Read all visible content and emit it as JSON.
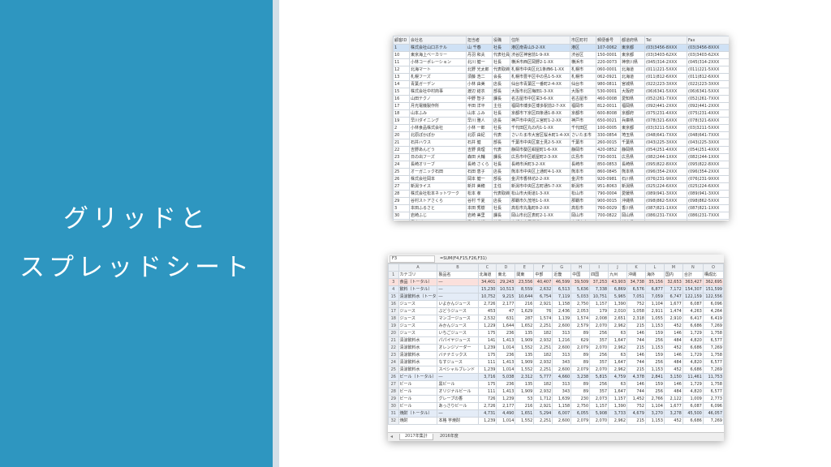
{
  "slide": {
    "title_lines": [
      "グリッドと",
      "スプレッドシート"
    ],
    "colors": {
      "panel": "#2e96c0",
      "strip": "#d3dfe8",
      "title": "#ffffff",
      "grid_selection": "#cfe1f5",
      "sheet_total_row": "#fbe0dc",
      "sheet_subtotal_row": "#e4ecf7"
    }
  },
  "grid": {
    "headers": [
      "顧客ID",
      "会社名",
      "担当者",
      "役職",
      "住所",
      "市区町村",
      "郵便番号",
      "都道府県",
      "Tel",
      "Fax"
    ],
    "rows": [
      [
        "1",
        "株式会社山口ホテル",
        "山 千春",
        "社長",
        "港区南青山3-2-XX",
        "港区",
        "107-0062",
        "東京都",
        "(03)3456-8XXX",
        "(03)3456-8XXX"
      ],
      [
        "10",
        "東京海上ベーカリー",
        "丹羽 和夫",
        "代表社員",
        "渋谷区神宮前1-9-XX",
        "渋谷区",
        "150-0001",
        "東京都",
        "(03)3403-62XX",
        "(03)3403-62XX"
      ],
      [
        "11",
        "小林コーポレーション",
        "北川 健一",
        "社長",
        "横浜市西区岡野2-1-XX",
        "横浜市",
        "220-0073",
        "神奈川県",
        "(045)314-2XXX",
        "(045)314-2XXX"
      ],
      [
        "12",
        "北海マート",
        "北野 光太郎",
        "代表取締役",
        "札幌市中央区北1条西6-1-XX",
        "札幌市",
        "060-0001",
        "北海道",
        "(011)221-5XXX",
        "(011)221-5XXX"
      ],
      [
        "13",
        "札幌フーズ",
        "須藤 浩二",
        "会長",
        "札幌市豊平区中の島1-5-XX",
        "札幌市",
        "062-0921",
        "北海道",
        "(011)812-6XXX",
        "(011)812-6XXX"
      ],
      [
        "14",
        "青葉ガーデン",
        "小林 由美",
        "店長",
        "仙台市青葉区一番町2-4-XX",
        "仙台市",
        "980-0811",
        "宮城県",
        "(022)223-3XXX",
        "(022)223-3XXX"
      ],
      [
        "15",
        "株式会社中村商事",
        "渡辺 結衣",
        "部長",
        "大阪市北区梅田1-3-XX",
        "大阪市",
        "530-0001",
        "大阪府",
        "(06)6341-5XXX",
        "(06)6341-5XXX"
      ],
      [
        "16",
        "山田テクノ",
        "中野 智子",
        "課長",
        "名古屋市中区栄3-6-XX",
        "名古屋市",
        "460-0008",
        "愛知県",
        "(052)261-7XXX",
        "(052)261-7XXX"
      ],
      [
        "17",
        "月光電機製作所",
        "平田 洋平",
        "主任",
        "福岡市博多区博多駅前2-7-XX",
        "福岡市",
        "812-0011",
        "福岡県",
        "(092)441-2XXX",
        "(092)441-2XXX"
      ],
      [
        "18",
        "山本ふみ",
        "山本 ふみ",
        "社長",
        "京都市下京区四条通1-8-XX",
        "京都市",
        "600-8008",
        "京都府",
        "(075)231-4XXX",
        "(075)231-4XXX"
      ],
      [
        "19",
        "早川ダイニング",
        "早川 雅人",
        "店長",
        "神戸市中央区三宮町1-2-XX",
        "神戸市",
        "650-0021",
        "兵庫県",
        "(078)321-6XXX",
        "(078)321-6XXX"
      ],
      [
        "2",
        "小林食品株式会社",
        "小林 一郎",
        "社長",
        "千代田区丸の内1-1-XX",
        "千代田区",
        "100-0005",
        "東京都",
        "(03)3211-5XXX",
        "(03)3211-5XXX"
      ],
      [
        "20",
        "北原ぽかぽか",
        "北原 由紀",
        "代表",
        "さいたま市大宮区桜木町1-4-XX",
        "さいたま市",
        "330-0854",
        "埼玉県",
        "(048)641-7XXX",
        "(048)641-7XXX"
      ],
      [
        "21",
        "石井ハウス",
        "石井 健",
        "部長",
        "千葉市中央区富士見2-5-XX",
        "千葉市",
        "260-0015",
        "千葉県",
        "(043)225-3XXX",
        "(043)225-3XXX"
      ],
      [
        "22",
        "吉野あんどう",
        "吉野 真理",
        "代表",
        "静岡市葵区紺屋町1-6-XX",
        "静岡市",
        "420-0852",
        "静岡県",
        "(054)251-4XXX",
        "(054)251-4XXX"
      ],
      [
        "23",
        "日の出フーズ",
        "森田 大輔",
        "課長",
        "広島市中区紙屋町2-3-XX",
        "広島市",
        "730-0031",
        "広島県",
        "(082)244-1XXX",
        "(082)244-1XXX"
      ],
      [
        "24",
        "長崎オリーブ",
        "長崎 さくら",
        "社長",
        "長崎市浜町3-2-XX",
        "長崎市",
        "850-0853",
        "長崎県",
        "(095)822-8XXX",
        "(095)822-8XXX"
      ],
      [
        "25",
        "オーガニック石田",
        "石田 恵子",
        "店長",
        "熊本市中央区上通町4-1-XX",
        "熊本市",
        "860-0845",
        "熊本県",
        "(096)354-2XXX",
        "(096)354-2XXX"
      ],
      [
        "26",
        "株式会社岡本",
        "岡本 健一",
        "部長",
        "金沢市香林坊2-2-XX",
        "金沢市",
        "920-0981",
        "石川県",
        "(076)231-9XXX",
        "(076)231-9XXX"
      ],
      [
        "27",
        "新潟ライス",
        "新井 美穂",
        "主任",
        "新潟市中央区古町通5-7-XX",
        "新潟市",
        "951-8063",
        "新潟県",
        "(025)224-6XXX",
        "(025)224-6XXX"
      ],
      [
        "28",
        "株式会社松本ネットワーク",
        "松本 孝",
        "代表取締役",
        "松山市大街道1-3-XX",
        "松山市",
        "790-0004",
        "愛媛県",
        "(089)941-3XXX",
        "(089)941-3XXX"
      ],
      [
        "29",
        "谷村ストアさくら",
        "谷村 千夏",
        "店長",
        "那覇市久茂地1-1-XX",
        "那覇市",
        "900-0015",
        "沖縄県",
        "(098)862-5XXX",
        "(098)862-5XXX"
      ],
      [
        "3",
        "本田ふるさと",
        "本田 秀樹",
        "社長",
        "高松市丸亀町8-2-XX",
        "高松市",
        "760-0029",
        "香川県",
        "(087)821-1XXX",
        "(087)821-1XXX"
      ],
      [
        "30",
        "岩崎ふじ",
        "岩崎 美里",
        "課長",
        "岡山市北区表町2-1-XX",
        "岡山市",
        "700-0822",
        "岡山県",
        "(086)231-7XXX",
        "(086)231-7XXX"
      ],
      [
        "31",
        "青木ばく",
        "青木 大輝",
        "社長",
        "宇都宮市馬場通り1-1-XX",
        "宇都宮市",
        "320-0026",
        "栃木県",
        "(028)633-2XXX",
        "(028)633-2XXX"
      ]
    ]
  },
  "sheet": {
    "namebox": "F3",
    "formula": "=SUM(F4,F15,F26,F31)",
    "col_letters": [
      "",
      "A",
      "B",
      "C",
      "D",
      "E",
      "F",
      "G",
      "H",
      "I",
      "J",
      "K",
      "L",
      "M",
      "N",
      "O"
    ],
    "header_row": [
      "1",
      "カテゴリ",
      "製品名",
      "北海道",
      "東北",
      "関東",
      "中部",
      "近畿",
      "中国",
      "四国",
      "九州",
      "沖縄",
      "海外",
      "国内",
      "合計",
      "構成比"
    ],
    "rows": [
      {
        "kind": "total",
        "cells": [
          "3",
          "食品（トータル）",
          "―",
          "34,401",
          "29,243",
          "23,556",
          "40,407",
          "46,599",
          "39,509",
          "37,253",
          "43,903",
          "34,738",
          "35,156",
          "32,653",
          "363,427",
          "362,695"
        ]
      },
      {
        "kind": "sub",
        "cells": [
          "4",
          "飲料（トータル）",
          "―",
          "15,230",
          "10,513",
          "8,559",
          "2,632",
          "6,513",
          "5,636",
          "7,338",
          "6,869",
          "6,576",
          "6,877",
          "7,172",
          "154,307",
          "151,599"
        ]
      },
      {
        "kind": "sub",
        "cells": [
          "15",
          "清涼飲料水（トータル）",
          "―",
          "10,752",
          "9,215",
          "10,644",
          "6,754",
          "7,119",
          "5,033",
          "10,751",
          "5,965",
          "7,051",
          "7,059",
          "6,747",
          "122,159",
          "122,556"
        ]
      },
      {
        "kind": "row",
        "cells": [
          "16",
          "ジュース",
          "いよかんジュース",
          "2,726",
          "2,177",
          "216",
          "2,921",
          "1,158",
          "2,750",
          "1,157",
          "1,390",
          "752",
          "1,104",
          "1,677",
          "6,087",
          "6,096"
        ]
      },
      {
        "kind": "row",
        "cells": [
          "17",
          "ジュース",
          "ぶどうジュース",
          "453",
          "47",
          "1,629",
          "76",
          "2,436",
          "2,053",
          "179",
          "2,010",
          "1,058",
          "2,911",
          "1,474",
          "4,263",
          "4,264"
        ]
      },
      {
        "kind": "row",
        "cells": [
          "18",
          "ジュース",
          "マンゴージュース",
          "2,532",
          "631",
          "287",
          "1,574",
          "1,139",
          "1,574",
          "2,008",
          "2,651",
          "2,318",
          "1,055",
          "2,910",
          "6,417",
          "6,419"
        ]
      },
      {
        "kind": "row",
        "cells": [
          "19",
          "ジュース",
          "みかんジュース",
          "1,229",
          "1,644",
          "1,652",
          "2,251",
          "2,600",
          "2,579",
          "2,070",
          "2,962",
          "215",
          "1,153",
          "452",
          "6,686",
          "7,269"
        ]
      },
      {
        "kind": "row",
        "cells": [
          "20",
          "ジュース",
          "いちごジュース",
          "175",
          "236",
          "135",
          "182",
          "313",
          "89",
          "256",
          "63",
          "146",
          "159",
          "146",
          "1,729",
          "1,758"
        ]
      },
      {
        "kind": "row",
        "cells": [
          "21",
          "清涼飲料水",
          "パパイヤジュース",
          "141",
          "1,413",
          "1,909",
          "2,932",
          "1,216",
          "629",
          "357",
          "1,647",
          "744",
          "256",
          "484",
          "4,820",
          "6,577"
        ]
      },
      {
        "kind": "row",
        "cells": [
          "22",
          "清涼飲料水",
          "オレンジソーダー",
          "1,239",
          "1,014",
          "1,552",
          "2,251",
          "2,600",
          "2,079",
          "2,070",
          "2,962",
          "215",
          "1,153",
          "452",
          "6,686",
          "7,269"
        ]
      },
      {
        "kind": "row",
        "cells": [
          "23",
          "清涼飲料水",
          "バナナミックス",
          "175",
          "236",
          "135",
          "182",
          "313",
          "89",
          "256",
          "63",
          "146",
          "159",
          "146",
          "1,729",
          "1,758"
        ]
      },
      {
        "kind": "row",
        "cells": [
          "24",
          "清涼飲料水",
          "なすジュース",
          "111",
          "1,413",
          "1,909",
          "2,932",
          "343",
          "89",
          "357",
          "1,647",
          "744",
          "256",
          "484",
          "4,820",
          "6,577"
        ]
      },
      {
        "kind": "row",
        "cells": [
          "25",
          "清涼飲料水",
          "スペシャルブレンド",
          "1,239",
          "1,014",
          "1,552",
          "2,251",
          "2,600",
          "2,079",
          "2,070",
          "2,962",
          "215",
          "1,153",
          "452",
          "6,686",
          "7,269"
        ]
      },
      {
        "kind": "sub",
        "cells": [
          "26",
          "ビール（トータル）",
          "―",
          "3,716",
          "5,038",
          "2,312",
          "5,777",
          "4,660",
          "3,238",
          "5,815",
          "4,759",
          "4,378",
          "2,841",
          "3,150",
          "11,461",
          "11,753"
        ]
      },
      {
        "kind": "row",
        "cells": [
          "27",
          "ビール",
          "黒ビール",
          "175",
          "236",
          "135",
          "182",
          "313",
          "89",
          "256",
          "63",
          "146",
          "159",
          "146",
          "1,729",
          "1,758"
        ]
      },
      {
        "kind": "row",
        "cells": [
          "28",
          "ビール",
          "オリジナルビール",
          "111",
          "1,413",
          "1,909",
          "2,932",
          "343",
          "89",
          "357",
          "1,647",
          "744",
          "256",
          "484",
          "4,820",
          "6,577"
        ]
      },
      {
        "kind": "row",
        "cells": [
          "29",
          "ビール",
          "グレープの香",
          "726",
          "1,239",
          "53",
          "1,712",
          "1,639",
          "230",
          "2,073",
          "1,157",
          "1,452",
          "2,766",
          "2,122",
          "1,009",
          "2,773"
        ]
      },
      {
        "kind": "row",
        "cells": [
          "30",
          "ビール",
          "あっさりビール",
          "2,726",
          "2,177",
          "216",
          "2,921",
          "1,158",
          "2,750",
          "1,157",
          "1,390",
          "752",
          "1,104",
          "1,677",
          "6,087",
          "6,096"
        ]
      },
      {
        "kind": "sub",
        "cells": [
          "31",
          "焼酎（トータル）",
          "―",
          "4,731",
          "4,490",
          "1,651",
          "5,294",
          "6,007",
          "6,055",
          "5,908",
          "3,733",
          "4,679",
          "3,270",
          "3,278",
          "45,500",
          "46,057"
        ]
      },
      {
        "kind": "row",
        "cells": [
          "32",
          "焼酎",
          "本格 芋焼酎",
          "1,239",
          "1,014",
          "1,552",
          "2,251",
          "2,600",
          "2,079",
          "2,070",
          "2,962",
          "215",
          "1,153",
          "452",
          "6,686",
          "7,269"
        ]
      }
    ],
    "tabs": [
      "2017年集計",
      "2016年度"
    ]
  }
}
